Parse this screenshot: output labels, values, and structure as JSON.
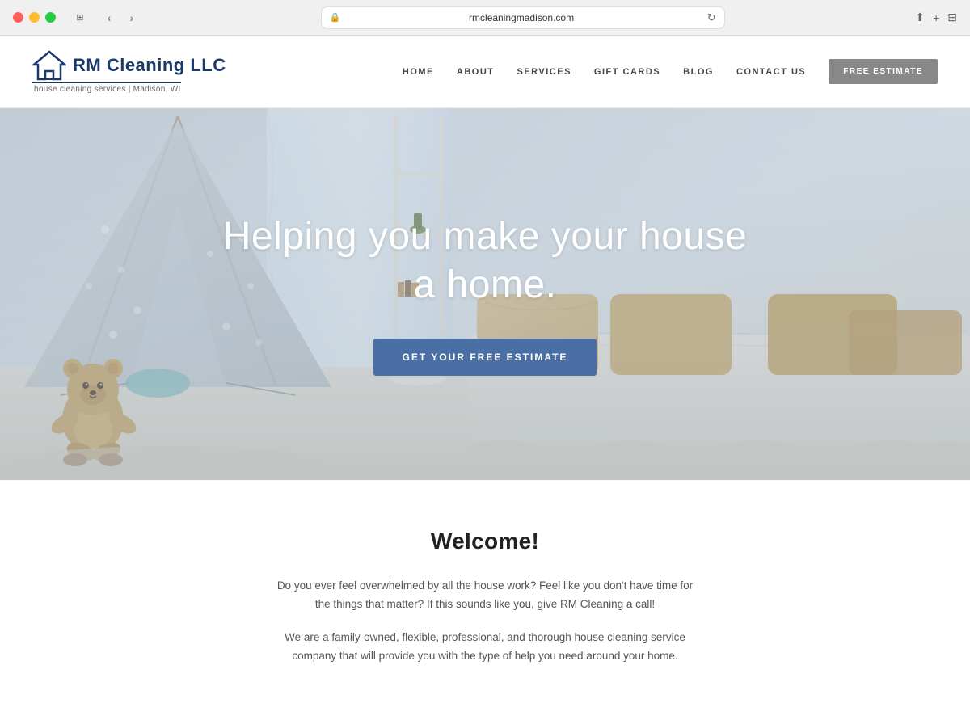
{
  "browser": {
    "url": "rmcleaningmadison.com"
  },
  "header": {
    "logo_text": "RM Cleaning LLC",
    "logo_tagline": "house cleaning services | Madison, WI",
    "nav": {
      "items": [
        {
          "label": "HOME"
        },
        {
          "label": "ABOUT"
        },
        {
          "label": "SERVICES"
        },
        {
          "label": "GIFT CARDS"
        },
        {
          "label": "BLOG"
        },
        {
          "label": "CONTACT US"
        }
      ],
      "cta_label": "FREE ESTIMATE"
    }
  },
  "hero": {
    "heading_line1": "Helping you make your house",
    "heading_line2": "a home.",
    "cta_label": "GET YOUR FREE ESTIMATE"
  },
  "welcome": {
    "title": "Welcome!",
    "paragraph1": "Do you ever feel overwhelmed by all the house work? Feel like you don't have time for the things that matter? If this sounds like you, give RM Cleaning a call!",
    "paragraph2": "We are a family-owned, flexible, professional, and thorough house cleaning service company that will provide you with the type of help you need around your home."
  }
}
